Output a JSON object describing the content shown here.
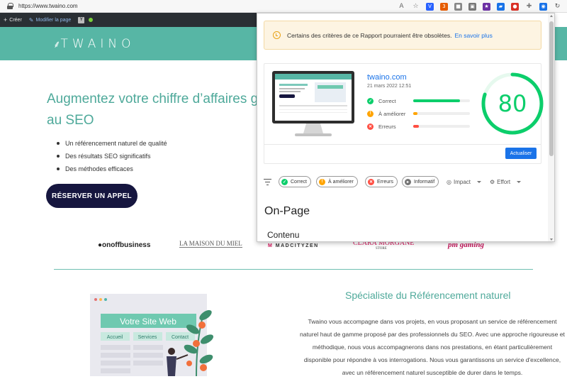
{
  "browser": {
    "url": "https://www.twaino.com",
    "extensions": [
      {
        "icon": "text-size-icon",
        "glyph": "A",
        "color": "#666"
      },
      {
        "icon": "star-icon",
        "glyph": "☆",
        "color": "#666"
      },
      {
        "icon": "v-extension-icon",
        "glyph": "V",
        "color": "#2962ff"
      },
      {
        "icon": "badge-extension-icon",
        "glyph": "3",
        "color": "#e65c00"
      },
      {
        "icon": "puzzle-icon",
        "glyph": "■",
        "color": "#888"
      },
      {
        "icon": "cube-extension-icon",
        "glyph": "▣",
        "color": "#777"
      },
      {
        "icon": "bookmark-extension-icon",
        "glyph": "★",
        "color": "#6b2fa3"
      },
      {
        "icon": "pdf-extension-icon",
        "glyph": "▰",
        "color": "#1a73e8"
      },
      {
        "icon": "red-badge-extension-icon",
        "glyph": "●",
        "color": "#d93025"
      },
      {
        "icon": "puzzle-piece-icon",
        "glyph": "✚",
        "color": "#777"
      },
      {
        "icon": "lighthouse-extension-icon",
        "glyph": "◉",
        "color": "#1a73e8"
      },
      {
        "icon": "refresh-icon",
        "glyph": "↻",
        "color": "#555"
      }
    ]
  },
  "wp_bar": {
    "create_label": "Créer",
    "edit_label": "Modifier la page"
  },
  "site": {
    "logo_text": "TWAINO",
    "hero_title": "Augmentez votre chiffre d’affaires g au SEO",
    "bullets": [
      "Un référencement naturel de qualité",
      "Des résultats SEO significatifs",
      "Des méthodes efficaces"
    ],
    "cta_label": "RÉSERVER UN APPEL",
    "brands": [
      "onoffbusiness",
      "LA MAISON DU MIEL",
      "MADCITYZEN",
      "CLARA MORGANE",
      "STORE",
      "pm gaming"
    ],
    "section_title": "Spécialiste du Référencement naturel",
    "section_text": "Twaino vous accompagne dans vos projets, en vous proposant un service de référencement naturel haut de gamme proposé par des professionnels du SEO. Avec une approche rigoureuse et méthodique, nous vous accompagnerons dans nos prestations, en étant particulièrement disponible pour répondre à vos interrogations. Nous vous garantissons un service d'excellence, avec un référencement naturel susceptible de durer dans le temps.",
    "illustration": {
      "title": "Votre Site Web",
      "nav": [
        "Accueil",
        "Services",
        "Contact"
      ]
    }
  },
  "lighthouse": {
    "warning_text": "Certains des critères de ce Rapport pourraient être obsolètes.",
    "warning_link": "En savoir plus",
    "site_name": "twaino.com",
    "report_date": "21 mars 2022 12:51",
    "score": "80",
    "score_fraction": 0.8,
    "metrics": [
      {
        "label": "Correct",
        "icon": "check-icon",
        "glyph": "✓",
        "color": "#0cce6b",
        "fraction": 0.82
      },
      {
        "label": "À améliorer",
        "icon": "warning-icon",
        "glyph": "!",
        "color": "#ffa400",
        "fraction": 0.08
      },
      {
        "label": "Erreurs",
        "icon": "error-icon",
        "glyph": "✕",
        "color": "#ff4e42",
        "fraction": 0.1
      }
    ],
    "update_label": "Actualiser",
    "filters": [
      {
        "label": "Correct",
        "icon": "check-icon",
        "glyph": "✓",
        "color": "#0cce6b"
      },
      {
        "label": "À améliorer",
        "icon": "warning-icon",
        "glyph": "!",
        "color": "#ffa400"
      },
      {
        "label": "Erreurs",
        "icon": "error-icon",
        "glyph": "✕",
        "color": "#ff4e42"
      },
      {
        "label": "Informatif",
        "icon": "info-icon",
        "glyph": "▸",
        "color": "#757575"
      }
    ],
    "sort_impact": "Impact",
    "sort_effort": "Effort",
    "section_title": "On-Page",
    "subsection_title": "Contenu"
  }
}
